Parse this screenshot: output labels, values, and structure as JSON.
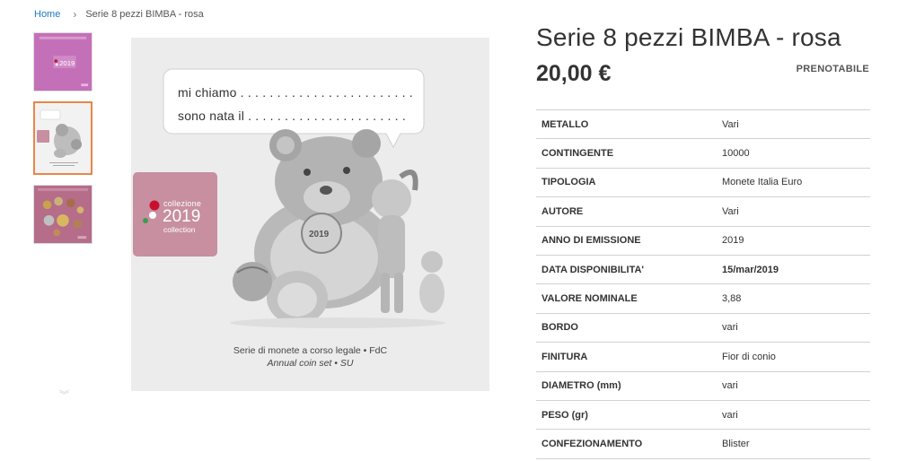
{
  "breadcrumb": {
    "home": "Home",
    "separator": "›",
    "current": "Serie 8 pezzi BIMBA - rosa"
  },
  "gallery": {
    "thumbnails": [
      {
        "id": "thumb-1",
        "kind": "pink-folder"
      },
      {
        "id": "thumb-2",
        "kind": "bear-drawing",
        "active": true
      },
      {
        "id": "thumb-3",
        "kind": "coin-set"
      }
    ],
    "down_icon": "chevron-down-icon",
    "main": {
      "bubble_line1": "mi chiamo . . . . . . . . . . . . . . . . . . . . . . . .",
      "bubble_line2": "sono nata il . . . . . . . . . . . . . . . . . . . . . .",
      "badge_top": "collezione",
      "badge_year": "2019",
      "badge_bottom": "collection",
      "caption_it": "Serie di monete a corso legale • FdC",
      "caption_en": "Annual coin set • SU"
    }
  },
  "product": {
    "title": "Serie 8 pezzi BIMBA - rosa",
    "price": "20,00 €",
    "availability": "PRENOTABILE"
  },
  "specs": [
    {
      "label": "METALLO",
      "value": "Vari"
    },
    {
      "label": "CONTINGENTE",
      "value": "10000"
    },
    {
      "label": "TIPOLOGIA",
      "value": "Monete Italia Euro"
    },
    {
      "label": "AUTORE",
      "value": "Vari"
    },
    {
      "label": "ANNO DI EMISSIONE",
      "value": "2019"
    },
    {
      "label": "DATA DISPONIBILITA'",
      "value": "15/mar/2019",
      "bold": true
    },
    {
      "label": "VALORE NOMINALE",
      "value": "3,88"
    },
    {
      "label": "BORDO",
      "value": "vari"
    },
    {
      "label": "FINITURA",
      "value": "Fior di conio"
    },
    {
      "label": "DIAMETRO (mm)",
      "value": "vari"
    },
    {
      "label": "PESO (gr)",
      "value": "vari"
    },
    {
      "label": "CONFEZIONAMENTO",
      "value": "Blister"
    }
  ],
  "colors": {
    "link": "#1979c3",
    "active_thumb_border": "#e8864a",
    "badge_pink": "#c78fa0",
    "folder_magenta": "#c470b8"
  }
}
